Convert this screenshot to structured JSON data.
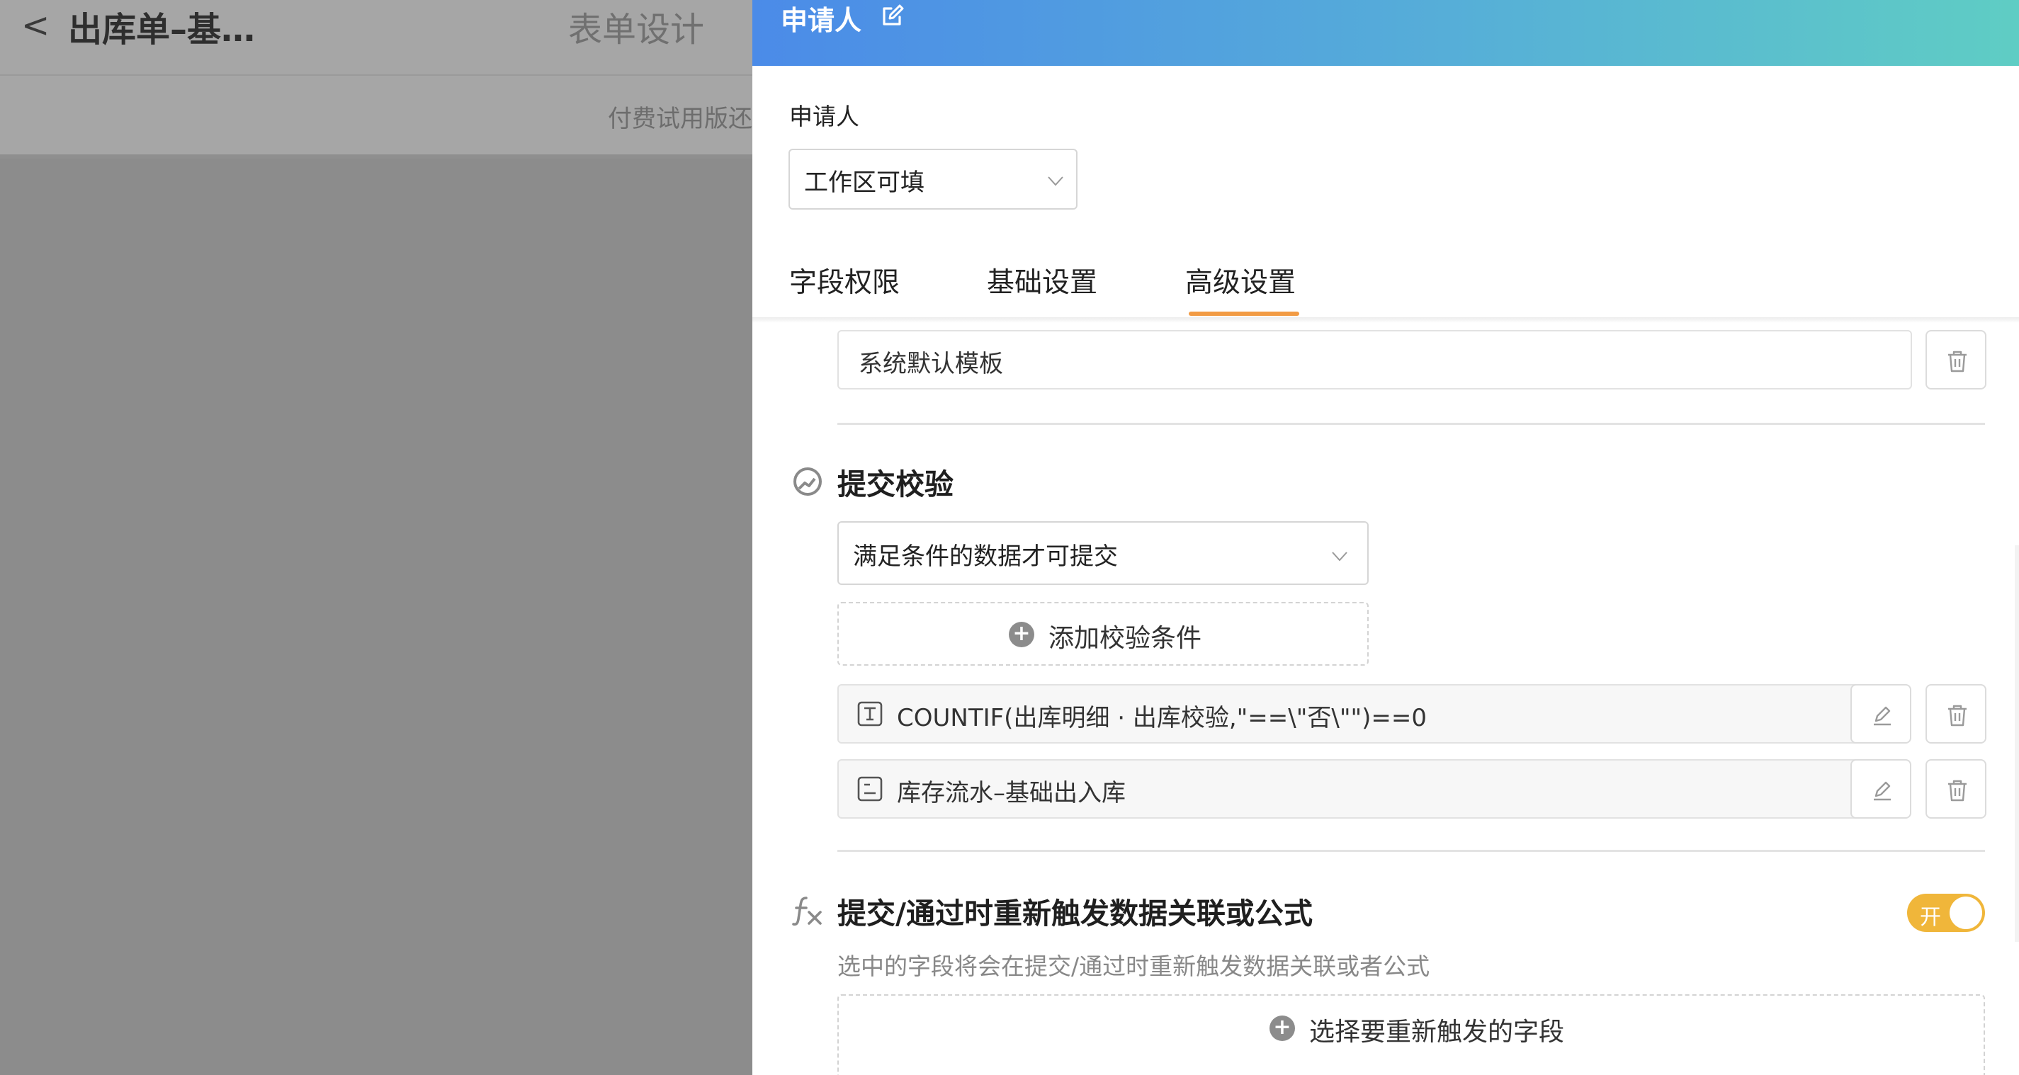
{
  "background": {
    "back_glyph": "<",
    "title": "出库单–基…",
    "tab": "表单设计",
    "notice": "付费试用版还"
  },
  "drawer": {
    "title": "申请人",
    "section_label": "申请人",
    "permission_select": {
      "value": "工作区可填"
    },
    "tabs": [
      {
        "label": "字段权限",
        "active": false
      },
      {
        "label": "基础设置",
        "active": false
      },
      {
        "label": "高级设置",
        "active": true
      }
    ],
    "template": {
      "value": "系统默认模板"
    },
    "submit_check": {
      "title": "提交校验",
      "select_value": "满足条件的数据才可提交",
      "add_button": "添加校验条件",
      "conditions": [
        {
          "icon": "formula-icon",
          "text": "COUNTIF(出库明细 · 出库校验,\"==\\\"否\\\"\")==0"
        },
        {
          "icon": "list-icon",
          "text": "库存流水–基础出入库"
        }
      ]
    },
    "retrigger": {
      "title": "提交/通过时重新触发数据关联或公式",
      "description": "选中的字段将会在提交/通过时重新触发数据关联或者公式",
      "toggle_label": "开",
      "toggle_on": true,
      "select_button": "选择要重新触发的字段"
    }
  },
  "colors": {
    "header_gradient_start": "#4b8be8",
    "header_gradient_end": "#5fcdc4",
    "tab_active_underline": "#f29b44",
    "toggle_on": "#f0b63a"
  }
}
